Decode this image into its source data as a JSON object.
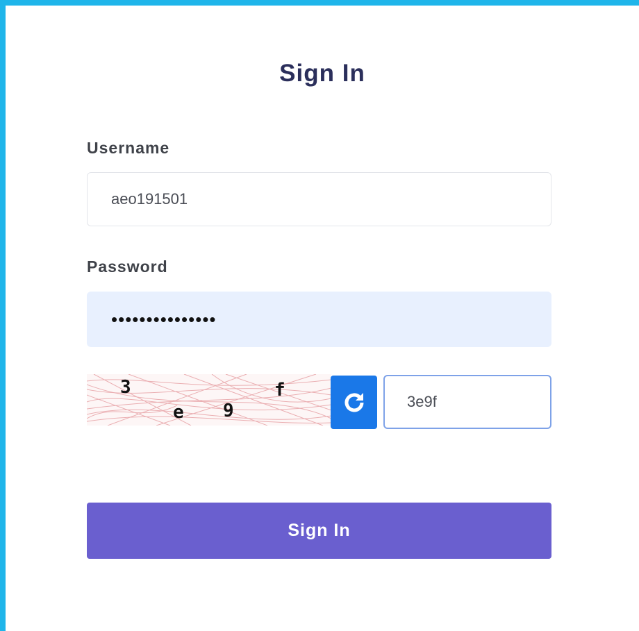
{
  "colors": {
    "frame_border": "#1fb5ea",
    "title_text": "#2b2f5b",
    "password_fill": "#e8f0fe",
    "refresh_button": "#1a78e8",
    "captcha_focus_border": "#7ea2e8",
    "submit_button": "#6a5fcf"
  },
  "form": {
    "title": "Sign In",
    "username": {
      "label": "Username",
      "value": "aeo191501"
    },
    "password": {
      "label": "Password",
      "masked_value": "•••••••••••••••"
    },
    "captcha": {
      "chars": [
        "3",
        "e",
        "9",
        "f"
      ],
      "refresh_icon": "refresh-icon",
      "input_value": "3e9f"
    },
    "submit_label": "Sign In"
  }
}
